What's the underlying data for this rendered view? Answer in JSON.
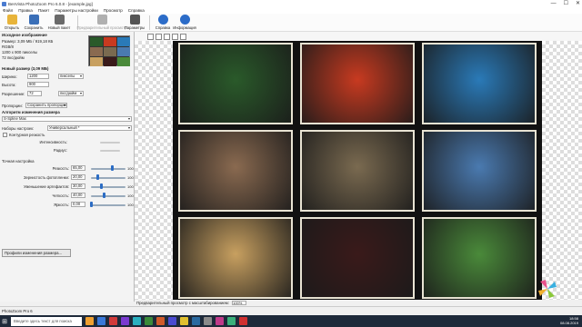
{
  "window": {
    "title": "BenVista PhotoZoom Pro 6.0.8 - [example.jpg]",
    "controls": [
      "—",
      "☐",
      "✕"
    ]
  },
  "menu": [
    "Файл",
    "Правка",
    "Пакет",
    "Параметры настройки",
    "Просмотр",
    "Справка"
  ],
  "toolbar": [
    {
      "label": "Открыть",
      "icon": "open-folder-icon",
      "color": "#e8b43a"
    },
    {
      "label": "Сохранить",
      "icon": "save-icon",
      "color": "#3a6fb8"
    },
    {
      "label": "Новый пакет",
      "icon": "batch-icon",
      "color": "#6a6a6a"
    },
    {
      "label": "Предварительный просмотр",
      "icon": "preview-icon",
      "color": "#b0b0b0",
      "disabled": true
    },
    {
      "label": "Параметры",
      "icon": "tools-icon",
      "color": "#555555"
    },
    {
      "label": "Справка",
      "icon": "help-icon",
      "color": "#2c6cc8"
    },
    {
      "label": "Информация",
      "icon": "info-icon",
      "color": "#2c6cc8"
    }
  ],
  "left": {
    "source_header": "Исходное изображение",
    "size_line": "Размер: 3,09 МБ / 919,18 КБ",
    "color_mode": "RGB/8",
    "dimensions": "1200 x 900 пикселы",
    "resolution": "72 пкс/дюйм",
    "new_size_header": "Новый размер (3,09 МБ)",
    "width_label": "Ширина:",
    "width_value": "1200",
    "width_unit": "пикселы",
    "height_label": "Высота:",
    "height_value": "900",
    "resolution_label": "Разрешение:",
    "resolution_value": "72",
    "resolution_unit": "пкс/дюйм",
    "proportions_label": "Пропорции:",
    "proportions_value": "Сохранить пропорции",
    "algorithm_header": "Алгоритм изменения размера",
    "algorithm_value": "S-Spline Max",
    "preset_label": "Наборы настроек:",
    "preset_value": "Универсальный *",
    "edge_checkbox": "Контурная резкость",
    "intensity_label": "Интенсивность:",
    "radius_label": "Радиус:",
    "fine_tune_header": "Точная настройка",
    "sliders": [
      {
        "label": "Резкость:",
        "value": "65,00",
        "max": "100",
        "fraction": 0.65
      },
      {
        "label": "Зернистость фотопленки:",
        "value": "20,00",
        "max": "100",
        "fraction": 0.2
      },
      {
        "label": "Уменьшение артефактов:",
        "value": "30,00",
        "max": "100",
        "fraction": 0.3
      },
      {
        "label": "Четкость:",
        "value": "40,00",
        "max": "100",
        "fraction": 0.4
      },
      {
        "label": "Яркость:",
        "value": "0,00",
        "max": "100",
        "fraction": 0.0
      }
    ],
    "profiles_button": "Профили изменения размера..."
  },
  "view": {
    "status_text": "Предварительный просмотр с масштабированием:",
    "zoom": "100%"
  },
  "statusbar": "PhotoZoom Pro 6",
  "taskbar": {
    "search_placeholder": "Введите здесь текст для поиска",
    "time": "18:58",
    "date": "08.08.2019",
    "apps": [
      "#f0a030",
      "#3a78d8",
      "#d03a3a",
      "#7a3ad0",
      "#2ab0c0",
      "#3a8a3a",
      "#d05a2a",
      "#4a4ad0",
      "#e0c030",
      "#2a6aa0",
      "#8a8a8a",
      "#c03a8a",
      "#3ab07a",
      "#d03030"
    ]
  },
  "tiles": [
    {
      "name": "daisy",
      "color": "#2a5a2a"
    },
    {
      "name": "fruits",
      "color": "#c83a20"
    },
    {
      "name": "fish",
      "color": "#2a7ab8"
    },
    {
      "name": "woman",
      "color": "#8a6a50"
    },
    {
      "name": "cat",
      "color": "#7a6a50"
    },
    {
      "name": "shell",
      "color": "#4a7ab0"
    },
    {
      "name": "food",
      "color": "#c8a060"
    },
    {
      "name": "feet",
      "color": "#3a1a1a"
    },
    {
      "name": "frog",
      "color": "#4a8a3a"
    }
  ]
}
